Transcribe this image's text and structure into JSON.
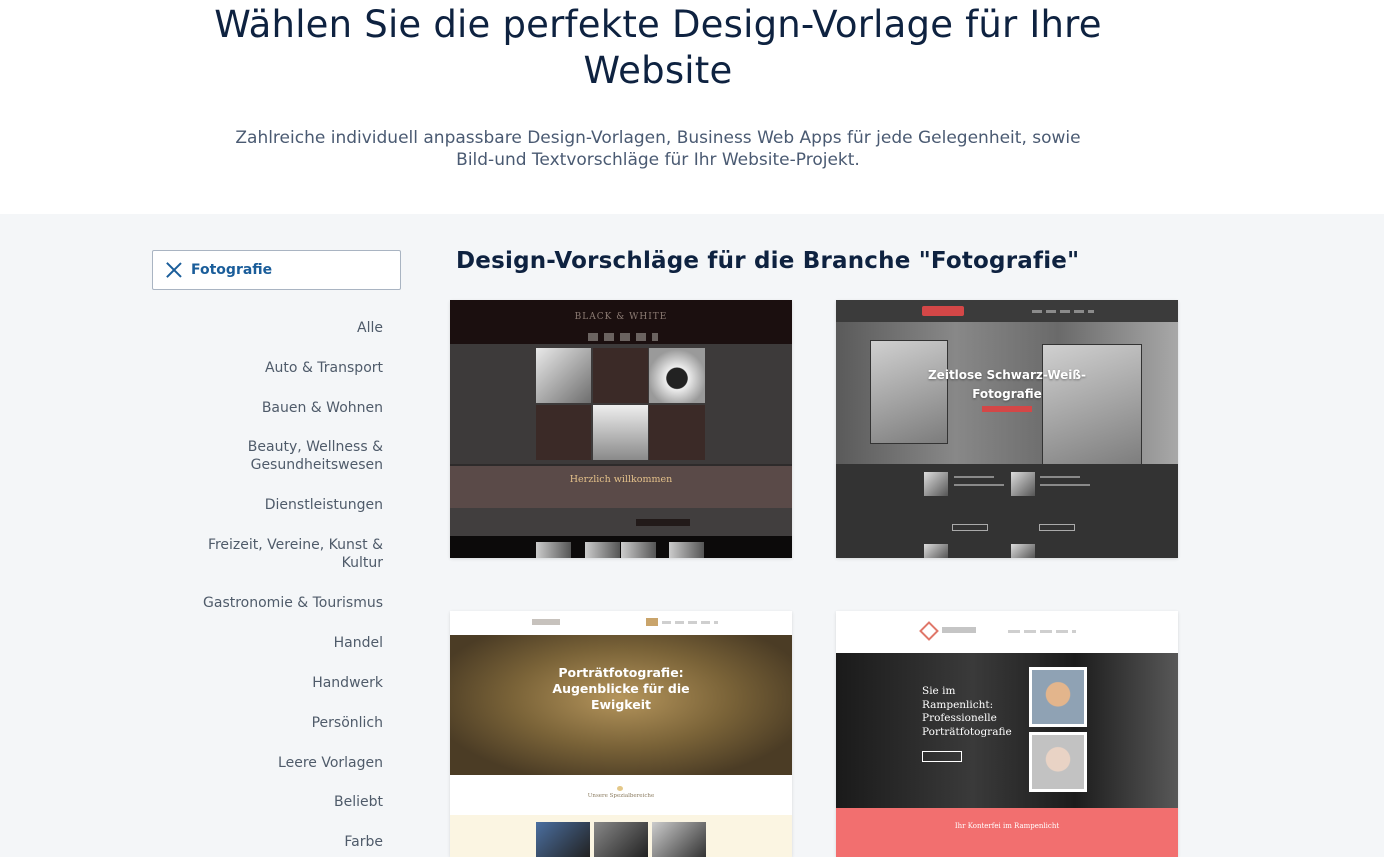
{
  "hero": {
    "title": "Wählen Sie die perfekte Design-Vorlage für Ihre Website",
    "subtitle": "Zahlreiche individuell anpassbare Design-Vorlagen, Business Web Apps für jede Gelegenheit, sowie Bild-und Textvorschläge für Ihr Website-Projekt."
  },
  "filter": {
    "active": "Fotografie",
    "clear_icon": "close-icon"
  },
  "categories": [
    "Alle",
    "Auto & Transport",
    "Bauen & Wohnen",
    "Beauty, Wellness & Gesundheitswesen",
    "Dienstleistungen",
    "Freizeit, Vereine, Kunst & Kultur",
    "Gastronomie & Tourismus",
    "Handel",
    "Handwerk",
    "Persönlich",
    "Leere Vorlagen",
    "Beliebt",
    "Farbe"
  ],
  "section": {
    "title": "Design-Vorschläge für die Branche \"Fotografie\""
  },
  "templates": [
    {
      "brand": "BLACK & WHITE",
      "welcome": "Herzlich willkommen"
    },
    {
      "headline": "Zeitlose Schwarz-Weiß-Fotografie"
    },
    {
      "headline": "Porträtfotografie: Augenblicke für die Ewigkeit",
      "section_label": "Unsere Spezialbereiche"
    },
    {
      "headline": "Sie im Rampenlicht: Professionelle Porträtfotografie",
      "footer_heading": "Ihr Konterfei im Rampenlicht"
    }
  ],
  "colors": {
    "accent": "#1a5d9a",
    "heading": "#0e2240",
    "section_bg": "#f4f6f8"
  }
}
